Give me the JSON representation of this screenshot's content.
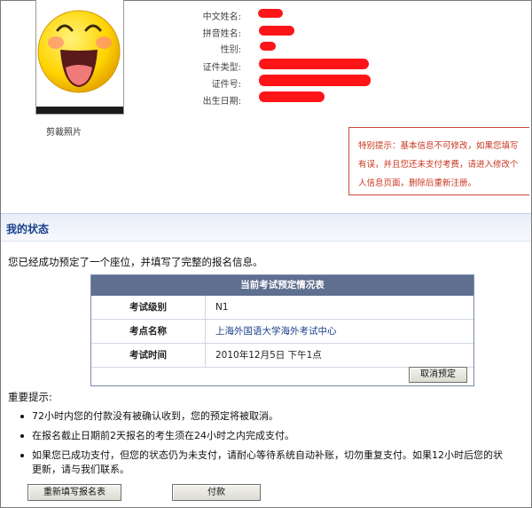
{
  "profile": {
    "crop_photo_label": "剪裁照片",
    "fields": [
      {
        "label": "中文姓名:"
      },
      {
        "label": "拼音姓名:"
      },
      {
        "label": "性别:"
      },
      {
        "label": "证件类型:"
      },
      {
        "label": "证件号:"
      },
      {
        "label": "出生日期:"
      }
    ],
    "notice": "特别提示：基本信息不可修改，如果您填写有误，并且您还未支付考费，请进入修改个人信息页面，删除后重新注册。"
  },
  "status": {
    "title": "我的状态",
    "intro": "您已经成功预定了一个座位，并填写了完整的报名信息。"
  },
  "booking": {
    "caption": "当前考试预定情况表",
    "rows": [
      {
        "key": "考试级别",
        "value": "N1"
      },
      {
        "key": "考点名称",
        "value": "上海外国语大学海外考试中心"
      },
      {
        "key": "考试时间",
        "value": "2010年12月5日  下午1点"
      }
    ],
    "cancel_label": "取消预定"
  },
  "notes": {
    "title": "重要提示:",
    "items": [
      "72小时内您的付款没有被确认收到，您的预定将被取消。",
      "在报名截止日期前2天报名的考生须在24小时之内完成支付。",
      "如果您已成功支付，但您的状态仍为未支付，请耐心等待系统自动补账，切勿重复支付。如果12小时后您的状",
      "更新，请与我们联系。"
    ]
  },
  "actions": {
    "refill_label": "重新填写报名表",
    "pay_label": "付款"
  },
  "colors": {
    "accent": "#1a3f8c",
    "table_header": "#5e6f8f",
    "notice_text": "#c8351e",
    "redaction": "#ff1418"
  }
}
